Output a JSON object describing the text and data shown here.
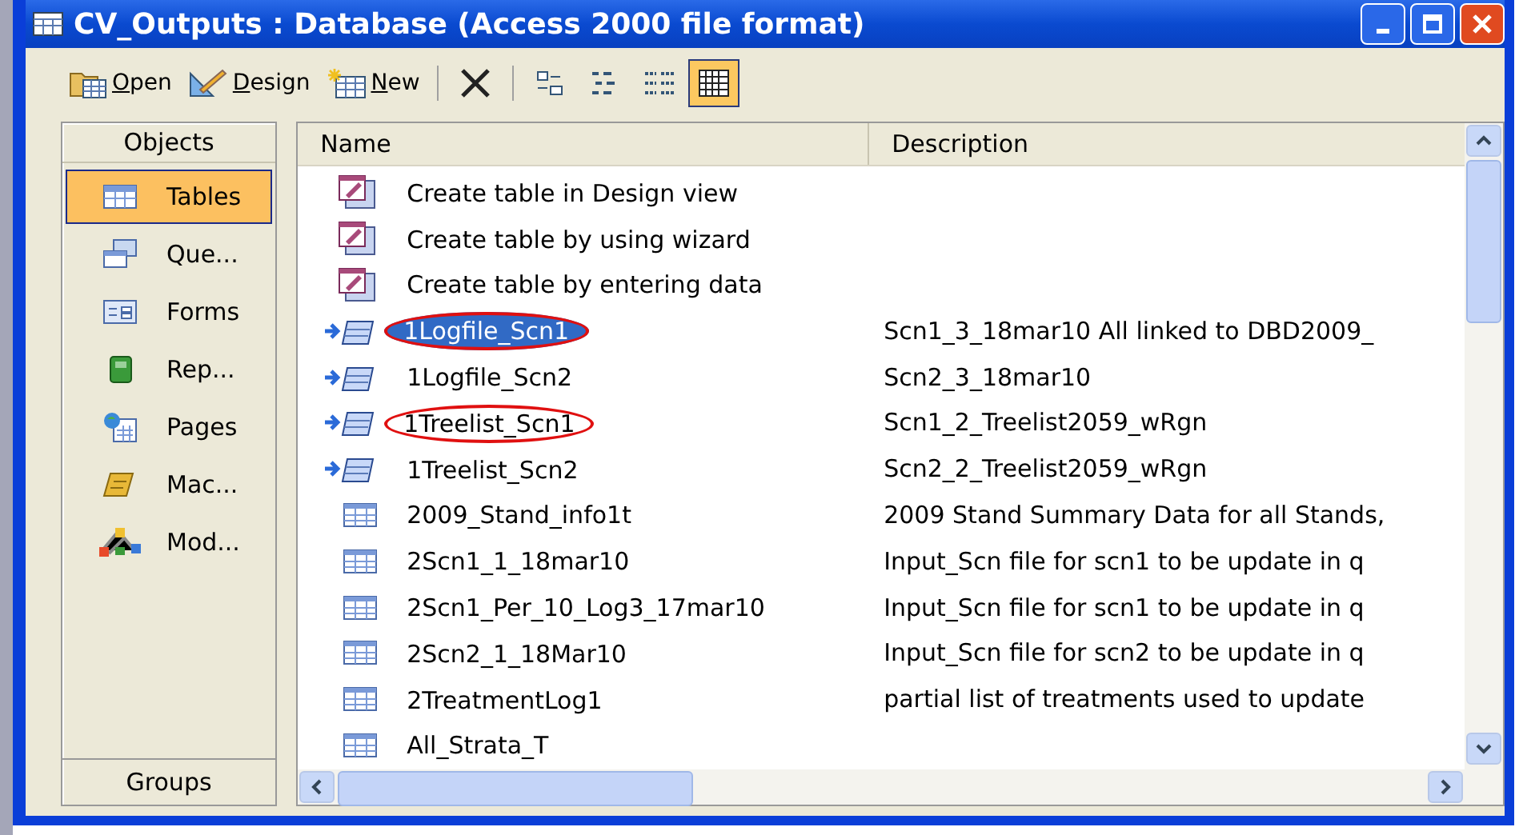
{
  "window": {
    "title": "CV_Outputs : Database (Access 2000 file format)"
  },
  "toolbar": {
    "actions": [
      {
        "label": "Open",
        "kind": "open"
      },
      {
        "label": "Design",
        "kind": "design"
      },
      {
        "label": "New",
        "kind": "new"
      }
    ],
    "views": [
      {
        "kind": "large",
        "selected": false
      },
      {
        "kind": "small",
        "selected": false
      },
      {
        "kind": "list",
        "selected": false
      },
      {
        "kind": "details",
        "selected": true
      }
    ]
  },
  "objects": {
    "title": "Objects",
    "items": [
      {
        "label": "Tables",
        "kind": "tables",
        "selected": true
      },
      {
        "label": "Que...",
        "kind": "queries",
        "selected": false
      },
      {
        "label": "Forms",
        "kind": "forms",
        "selected": false
      },
      {
        "label": "Rep...",
        "kind": "reports",
        "selected": false
      },
      {
        "label": "Pages",
        "kind": "pages",
        "selected": false
      },
      {
        "label": "Mac...",
        "kind": "macros",
        "selected": false
      },
      {
        "label": "Mod...",
        "kind": "modules",
        "selected": false
      }
    ],
    "groups": "Groups"
  },
  "list": {
    "columns": [
      "Name",
      "Description"
    ],
    "rows": [
      {
        "kind": "create",
        "name": "Create table in Design view",
        "selected": false,
        "circled": false
      },
      {
        "kind": "create",
        "name": "Create table by using wizard",
        "selected": false,
        "circled": false
      },
      {
        "kind": "create",
        "name": "Create table by entering data",
        "selected": false,
        "circled": false
      },
      {
        "kind": "linked",
        "name": "1Logfile_Scn1",
        "description": "Scn1_3_18mar10 All linked to DBD2009_",
        "selected": true,
        "circled": true
      },
      {
        "kind": "linked",
        "name": "1Logfile_Scn2",
        "description": "Scn2_3_18mar10",
        "selected": false,
        "circled": false
      },
      {
        "kind": "linked",
        "name": "1Treelist_Scn1",
        "description": "Scn1_2_Treelist2059_wRgn",
        "selected": false,
        "circled": true
      },
      {
        "kind": "linked",
        "name": "1Treelist_Scn2",
        "description": "Scn2_2_Treelist2059_wRgn",
        "selected": false,
        "circled": false
      },
      {
        "kind": "table",
        "name": "2009_Stand_info1t",
        "description": "2009 Stand Summary Data for all Stands,",
        "selected": false,
        "circled": false
      },
      {
        "kind": "table",
        "name": "2Scn1_1_18mar10",
        "description": "Input_Scn file for scn1 to be update in q",
        "selected": false,
        "circled": false
      },
      {
        "kind": "table",
        "name": "2Scn1_Per_10_Log3_17mar10",
        "description": "Input_Scn file for scn1 to be update in q",
        "selected": false,
        "circled": false
      },
      {
        "kind": "table",
        "name": "2Scn2_1_18Mar10",
        "description": "Input_Scn file for scn2 to be update in q",
        "selected": false,
        "circled": false
      },
      {
        "kind": "table",
        "name": "2TreatmentLog1",
        "description": "partial list of treatments used to update",
        "selected": false,
        "circled": false
      },
      {
        "kind": "table",
        "name": "All_Strata_T",
        "selected": false,
        "circled": false
      }
    ]
  }
}
